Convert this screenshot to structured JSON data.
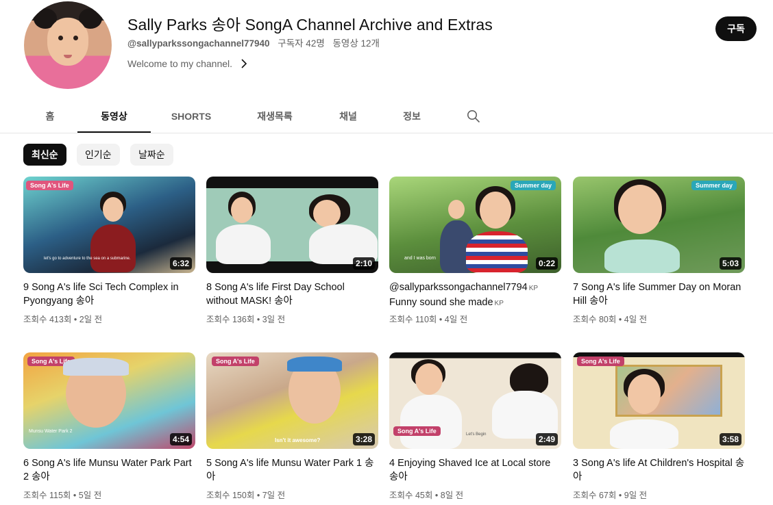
{
  "channel": {
    "title": "Sally Parks 송아 SongA Channel Archive and Extras",
    "handle": "@sallyparkssongachannel77940",
    "subscribers": "구독자 42명",
    "video_count": "동영상 12개",
    "description": "Welcome to my channel.",
    "subscribe_label": "구독"
  },
  "tabs": [
    "홈",
    "동영상",
    "SHORTS",
    "재생목록",
    "채널",
    "정보"
  ],
  "active_tab": "동영상",
  "chips": [
    "최신순",
    "인기순",
    "날짜순"
  ],
  "active_chip": "최신순",
  "videos": [
    {
      "title": "9 Song A's life Sci Tech Complex in Pyongyang 송아",
      "kp": "",
      "duration": "6:32",
      "views": "조회수 413회",
      "age": "2일 전",
      "logo": "Song A's Life",
      "caption": "let's go to adventure to the sea on a submarine."
    },
    {
      "title": "8 Song A's life First Day School without MASK! 송아",
      "kp": "",
      "duration": "2:10",
      "views": "조회수 136회",
      "age": "3일 전",
      "logo": "",
      "caption": ""
    },
    {
      "title": "@sallyparkssongachannel7794",
      "kp": "KP",
      "title2": "Funny sound she made",
      "kp2": "KP",
      "duration": "0:22",
      "views": "조회수 110회",
      "age": "4일 전",
      "logo": "Summer day",
      "caption": "and I was born"
    },
    {
      "title": "7 Song A's life Summer Day on Moran Hill 송아",
      "kp": "",
      "duration": "5:03",
      "views": "조회수 80회",
      "age": "4일 전",
      "logo": "Summer day",
      "caption": ""
    },
    {
      "title": "6 Song A's life Munsu Water Park Part 2 송아",
      "kp": "",
      "duration": "4:54",
      "views": "조회수 115회",
      "age": "5일 전",
      "logo": "Song A's Life",
      "caption": "Munsu Water Park 2"
    },
    {
      "title": "5 Song A's life Munsu Water Park 1 송아",
      "kp": "",
      "duration": "3:28",
      "views": "조회수 150회",
      "age": "7일 전",
      "logo": "Song A's Life",
      "caption": "Isn't it awesome?"
    },
    {
      "title": "4 Enjoying Shaved Ice at Local store 송아",
      "kp": "",
      "duration": "2:49",
      "views": "조회수 45회",
      "age": "8일 전",
      "logo": "Song A's Life",
      "caption": "Let's Begin"
    },
    {
      "title": "3 Song A's life At Children's Hospital 송아",
      "kp": "",
      "duration": "3:58",
      "views": "조회수 67회",
      "age": "9일 전",
      "logo": "Song A's Life",
      "caption": ""
    }
  ],
  "meta_separator": "•",
  "colors": {
    "text_primary": "#0f0f0f",
    "text_secondary": "#606060",
    "subscribe_bg": "#0f0f0f",
    "chip_bg": "#f2f2f2",
    "scarf_red": "#d9232d"
  },
  "icons": {
    "description_more": "chevron-right-icon",
    "tab_search": "search-icon"
  }
}
